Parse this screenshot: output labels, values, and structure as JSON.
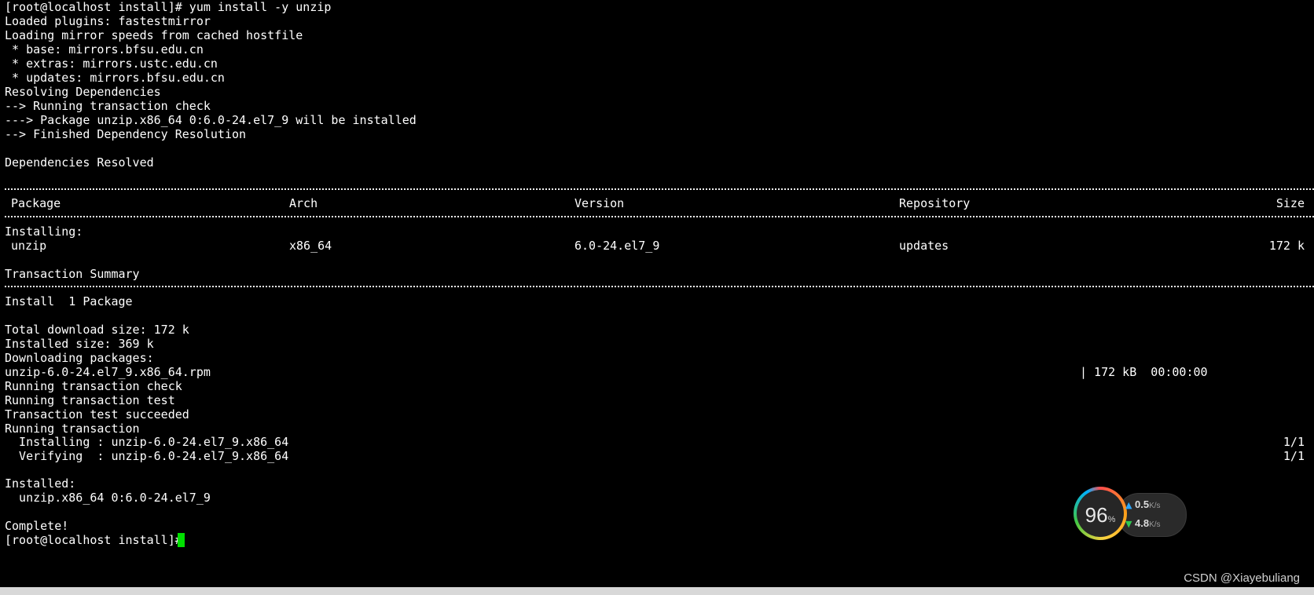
{
  "terminal": {
    "lines": [
      "[root@localhost install]# yum install -y unzip",
      "Loaded plugins: fastestmirror",
      "Loading mirror speeds from cached hostfile",
      " * base: mirrors.bfsu.edu.cn",
      " * extras: mirrors.ustc.edu.cn",
      " * updates: mirrors.bfsu.edu.cn",
      "Resolving Dependencies",
      "--> Running transaction check",
      "---> Package unzip.x86_64 0:6.0-24.el7_9 will be installed",
      "--> Finished Dependency Resolution",
      "",
      "Dependencies Resolved"
    ],
    "table": {
      "headers": [
        "Package",
        "Arch",
        "Version",
        "Repository",
        "Size"
      ],
      "section": "Installing:",
      "row": [
        "unzip",
        "x86_64",
        "6.0-24.el7_9",
        "updates",
        "172 k"
      ]
    },
    "summary_title": "Transaction Summary",
    "install_count": "Install  1 Package",
    "lines2": [
      "Total download size: 172 k",
      "Installed size: 369 k",
      "Downloading packages:"
    ],
    "download": {
      "file": "unzip-6.0-24.el7_9.x86_64.rpm",
      "stats": "| 172 kB  00:00:00"
    },
    "lines3": [
      "Running transaction check",
      "Running transaction test",
      "Transaction test succeeded",
      "Running transaction"
    ],
    "steps": [
      {
        "text": "  Installing : unzip-6.0-24.el7_9.x86_64",
        "progress": "1/1"
      },
      {
        "text": "  Verifying  : unzip-6.0-24.el7_9.x86_64",
        "progress": "1/1"
      }
    ],
    "installed_title": "Installed:",
    "installed_pkg": "  unzip.x86_64 0:6.0-24.el7_9",
    "complete": "Complete!",
    "prompt": "[root@localhost install]# "
  },
  "widget": {
    "cpu_value": "96",
    "cpu_unit": "%",
    "upload_value": "0.5",
    "download_value": "4.8",
    "speed_unit": "K/s",
    "upload_arrow_color": "#2aa7ff",
    "download_arrow_color": "#30c850"
  },
  "watermark": "CSDN @Xiayebuliang"
}
